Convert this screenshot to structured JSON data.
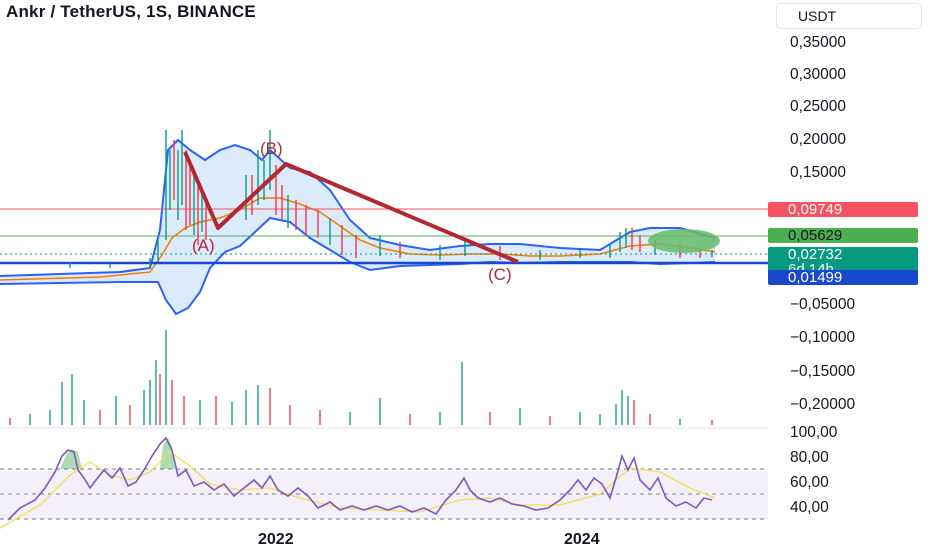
{
  "header": {
    "title": "Ankr / TetherUS, 1S, BINANCE",
    "currency": "USDT"
  },
  "price_axis": {
    "labels": [
      "0,35000",
      "0,30000",
      "0,25000",
      "0,20000",
      "0,15000",
      "−0,05000",
      "−0,10000",
      "−0,15000",
      "−0,20000"
    ]
  },
  "price_tags": {
    "resistance": "0,09749",
    "green_level": "0,05629",
    "current_price": "0,02732",
    "countdown": "6d 14h",
    "support": "0,01499"
  },
  "rsi_axis": {
    "labels": [
      "100,00",
      "80,00",
      "60,00",
      "40,00"
    ]
  },
  "time_axis": {
    "labels": [
      "2022",
      "2024"
    ]
  },
  "annotations": {
    "wave_a": "(A)",
    "wave_b": "(B)",
    "wave_c": "(C)"
  },
  "colors": {
    "resistance_red": "#f7525f",
    "green_level": "#4caf50",
    "current_teal": "#089981",
    "support_blue": "#1848cc",
    "wave_line": "#b22833",
    "bollinger": "#2962ff"
  }
}
